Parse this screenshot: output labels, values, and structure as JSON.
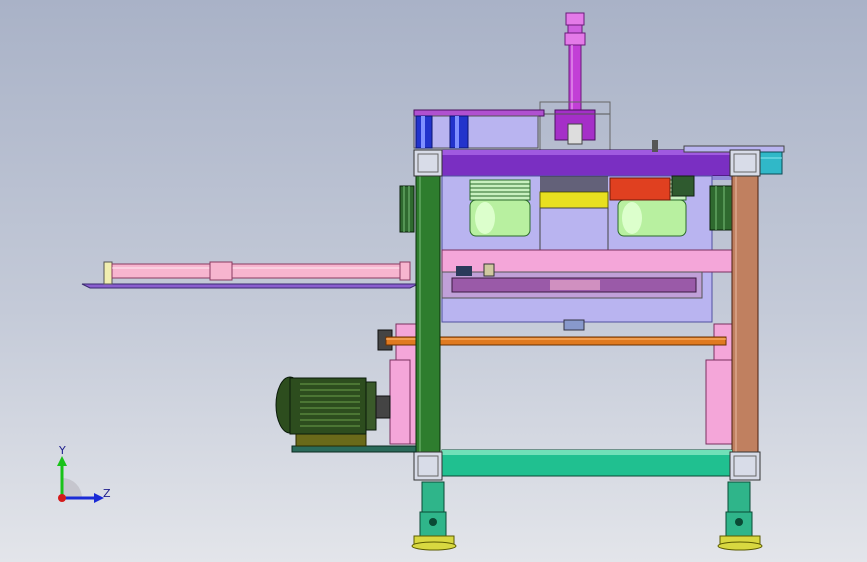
{
  "viewport": {
    "background_top": "#a9b2c7",
    "background_bottom": "#e3e5ea"
  },
  "triad": {
    "y_label": "Y",
    "z_label": "Z",
    "y_color": "#19c219",
    "z_color": "#1a2bd6",
    "x_color": "#d41a1a"
  },
  "colors": {
    "frame_green": "#2e7d2e",
    "frame_brown": "#c08060",
    "top_beam": "#7a2fc2",
    "base_beam": "#20c090",
    "pink": "#f4a6d9",
    "lavender": "#b9b4f0",
    "rod_pink": "#f7b5cf",
    "orange_shaft": "#e07a20",
    "yellow": "#e8e020",
    "red_block": "#e04020",
    "motor_green": "#2d4d1e",
    "foot_green": "#2fb58a",
    "foot_yellow": "#d8d840",
    "cylinder_magenta": "#c23fd6",
    "blue_roller": "#2233cc",
    "cyan": "#30b8c8"
  },
  "icons": [
    "coordinate-triad-icon"
  ]
}
